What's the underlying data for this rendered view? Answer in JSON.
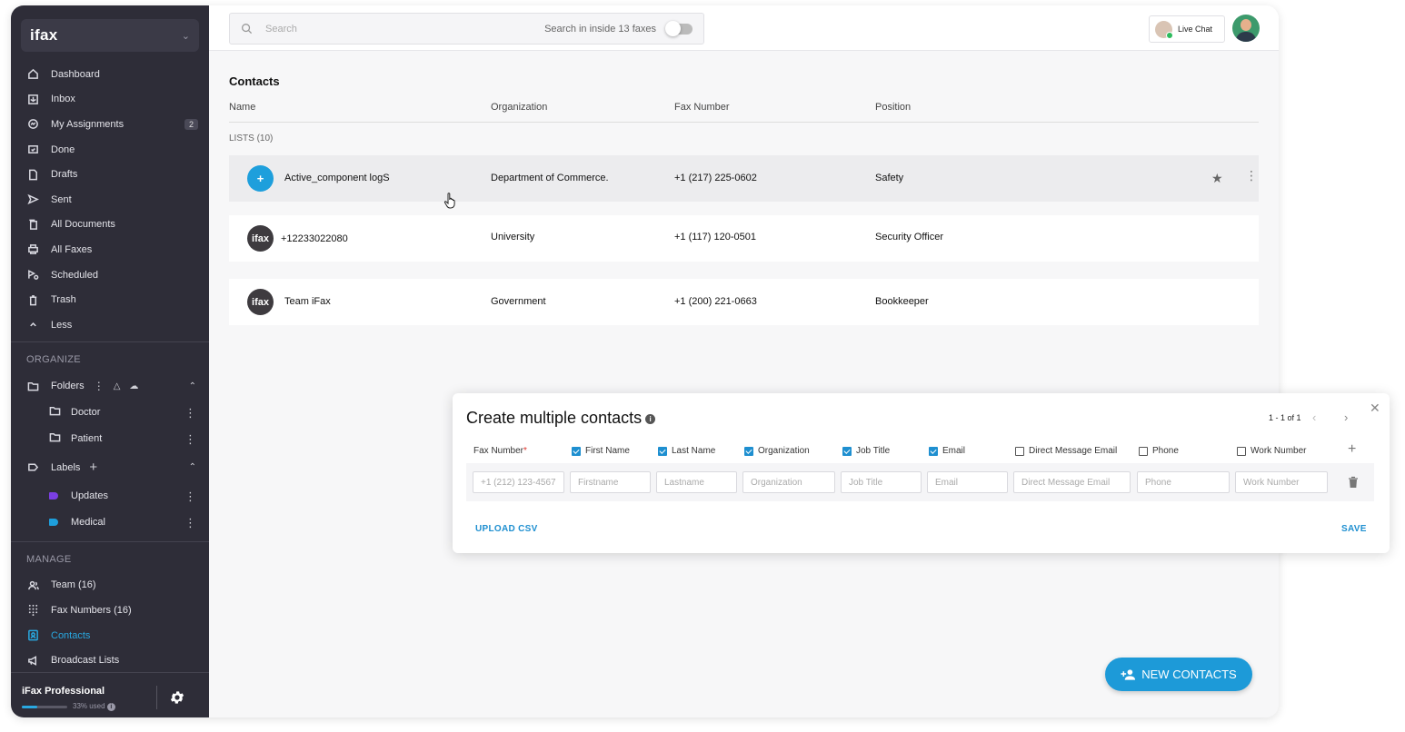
{
  "brand": {
    "logo": "ifax"
  },
  "nav": [
    {
      "label": "Dashboard",
      "icon": "home-icon"
    },
    {
      "label": "Inbox",
      "icon": "inbox-icon"
    },
    {
      "label": "My Assignments",
      "icon": "assignments-icon",
      "badge": "2"
    },
    {
      "label": "Done",
      "icon": "done-icon"
    },
    {
      "label": "Drafts",
      "icon": "drafts-icon"
    },
    {
      "label": "Sent",
      "icon": "sent-icon"
    },
    {
      "label": "All Documents",
      "icon": "documents-icon"
    },
    {
      "label": "All Faxes",
      "icon": "printer-icon"
    },
    {
      "label": "Scheduled",
      "icon": "scheduled-icon"
    },
    {
      "label": "Trash",
      "icon": "trash-icon"
    },
    {
      "label": "Less",
      "icon": "chevron-up-icon"
    }
  ],
  "organize": {
    "title": "ORGANIZE",
    "folders_label": "Folders",
    "folders": [
      "Doctor",
      "Patient"
    ],
    "labels_label": "Labels",
    "labels": [
      {
        "label": "Updates",
        "color": "#7b3fe4"
      },
      {
        "label": "Medical",
        "color": "#1e9fdc"
      }
    ]
  },
  "manage": {
    "title": "MANAGE",
    "items": [
      {
        "label": "Team (16)",
        "icon": "team-icon"
      },
      {
        "label": "Fax Numbers (16)",
        "icon": "dialpad-icon"
      },
      {
        "label": "Contacts",
        "icon": "contacts-icon",
        "active": true
      },
      {
        "label": "Broadcast Lists",
        "icon": "megaphone-icon"
      }
    ]
  },
  "plan": {
    "name": "iFax Professional",
    "used": "33% used",
    "used_fraction": 0.33
  },
  "topbar": {
    "search_placeholder": "Search",
    "search_inside": "Search in inside 13 faxes",
    "live_chat": "Live Chat"
  },
  "contacts": {
    "title": "Contacts",
    "columns": [
      "Name",
      "Organization",
      "Fax Number",
      "Position"
    ],
    "lists_label": "LISTS (10)",
    "rows": [
      {
        "avatar": "+",
        "name": "Active_component logS",
        "organization": "Department of Commerce.",
        "fax": "+1 (217) 225-0602",
        "position": "Safety"
      },
      {
        "avatar": "ifax",
        "name": "+12233022080",
        "organization": "University",
        "fax": "+1 (117) 120-0501",
        "position": "Security Officer"
      },
      {
        "avatar": "ifax",
        "name": "Team iFax",
        "organization": "Government",
        "fax": "+1 (200) 221-0663",
        "position": "Bookkeeper"
      }
    ]
  },
  "modal": {
    "title": "Create multiple contacts",
    "pager": "1 - 1 of 1",
    "fields": [
      {
        "label": "Fax Number",
        "required": true,
        "checked": null,
        "placeholder": "+1 (212) 123-4567"
      },
      {
        "label": "First Name",
        "checked": true,
        "placeholder": "Firstname"
      },
      {
        "label": "Last Name",
        "checked": true,
        "placeholder": "Lastname"
      },
      {
        "label": "Organization",
        "checked": true,
        "placeholder": "Organization"
      },
      {
        "label": "Job Title",
        "checked": true,
        "placeholder": "Job Title"
      },
      {
        "label": "Email",
        "checked": true,
        "placeholder": "Email"
      },
      {
        "label": "Direct Message Email",
        "checked": false,
        "placeholder": "Direct Message Email"
      },
      {
        "label": "Phone",
        "checked": false,
        "placeholder": "Phone"
      },
      {
        "label": "Work Number",
        "checked": false,
        "placeholder": "Work Number"
      }
    ],
    "upload_csv": "UPLOAD CSV",
    "save": "SAVE"
  },
  "fab": {
    "label": "NEW CONTACTS"
  },
  "colors": {
    "accent": "#1e9fdc",
    "sidebar": "#2e2d38"
  }
}
